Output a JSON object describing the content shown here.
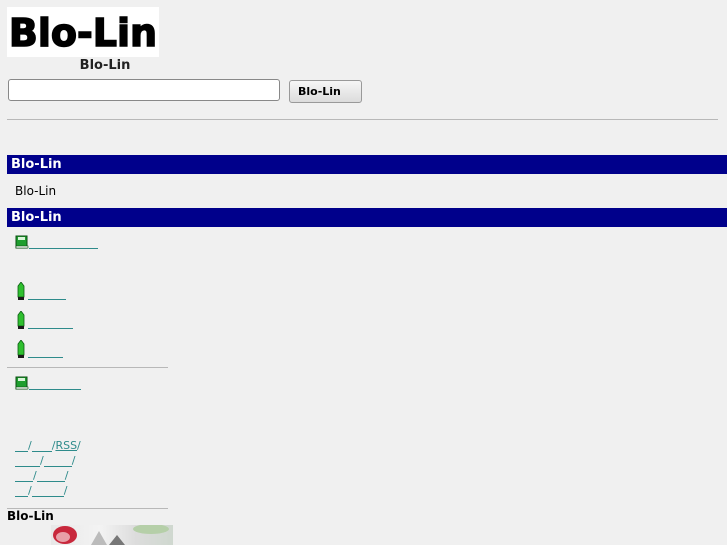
{
  "header": {
    "logo_text": "Blo-Lin",
    "site_name": "Blo-Lin"
  },
  "search": {
    "value": "",
    "placeholder": "",
    "button_label": "Blo-Lin"
  },
  "section1": {
    "title": "Blo-Lin",
    "body": "Blo-Lin"
  },
  "section2": {
    "title": "Blo-Lin"
  },
  "path_links": {
    "rss_label": "RSS"
  },
  "footer": {
    "title": "Blo-Lin"
  },
  "colors": {
    "section_bar": "#00008b",
    "link": "#2e8b8b",
    "book_icon": "#1e9e2e",
    "pencil_icon": "#2fbf2f"
  }
}
